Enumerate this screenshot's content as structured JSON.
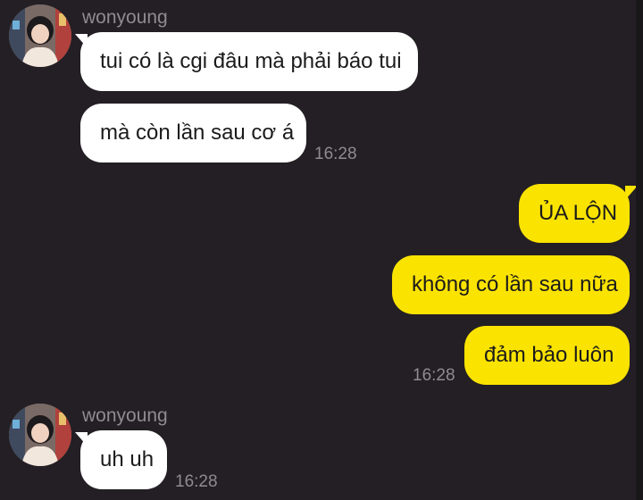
{
  "groups": [
    {
      "sender": "wonyoung",
      "avatar_icon": "profile-photo-avatar",
      "messages": [
        "tui có là cgi đâu mà phải báo tui",
        "mà còn lần sau cơ á"
      ],
      "time": "16:28"
    },
    {
      "sender": "me",
      "messages": [
        "ỦA LỘN",
        "không có lần sau nữa",
        "đảm bảo luôn"
      ],
      "time": "16:28"
    },
    {
      "sender": "wonyoung",
      "avatar_icon": "profile-photo-avatar",
      "messages": [
        "uh uh"
      ],
      "time": "16:28"
    }
  ],
  "colors": {
    "background": "#231f24",
    "incoming_bubble": "#ffffff",
    "outgoing_bubble": "#fbe300",
    "meta_text": "#8e8b91"
  }
}
